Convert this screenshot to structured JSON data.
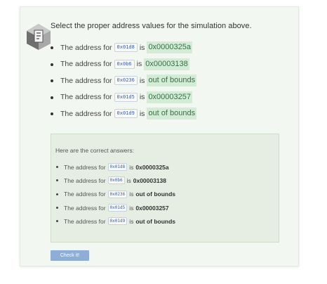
{
  "prompt": "Select the proper address values for the simulation above.",
  "choices": [
    {
      "prefix": "The address for",
      "code": "0x01d8",
      "is": "is",
      "answer": "0x0000325a"
    },
    {
      "prefix": "The address for",
      "code": "0x0b6",
      "is": "is",
      "answer": "0x00003138"
    },
    {
      "prefix": "The address for",
      "code": "0x0236",
      "is": "is",
      "answer": "out of bounds"
    },
    {
      "prefix": "The address for",
      "code": "0x01d5",
      "is": "is",
      "answer": "0x00003257"
    },
    {
      "prefix": "The address for",
      "code": "0x01d9",
      "is": "is",
      "answer": "out of bounds"
    }
  ],
  "answers": {
    "title": "Here are the correct answers:",
    "items": [
      {
        "prefix": "The address for",
        "code": "0x01d8",
        "is": "is",
        "answer": "0x0000325a"
      },
      {
        "prefix": "The address for",
        "code": "0x0b6",
        "is": "is",
        "answer": "0x00003138"
      },
      {
        "prefix": "The address for",
        "code": "0x0236",
        "is": "is",
        "answer": "out of bounds"
      },
      {
        "prefix": "The address for",
        "code": "0x01d5",
        "is": "is",
        "answer": "0x00003257"
      },
      {
        "prefix": "The address for",
        "code": "0x01d9",
        "is": "is",
        "answer": "out of bounds"
      }
    ]
  },
  "check_button": "Check it!",
  "colors": {
    "selected_bg": "#d3ecd6",
    "answers_bg": "#e6eee3",
    "button_bg": "#8eaed8"
  },
  "icons": {
    "logo": "participation-activity-icon"
  }
}
